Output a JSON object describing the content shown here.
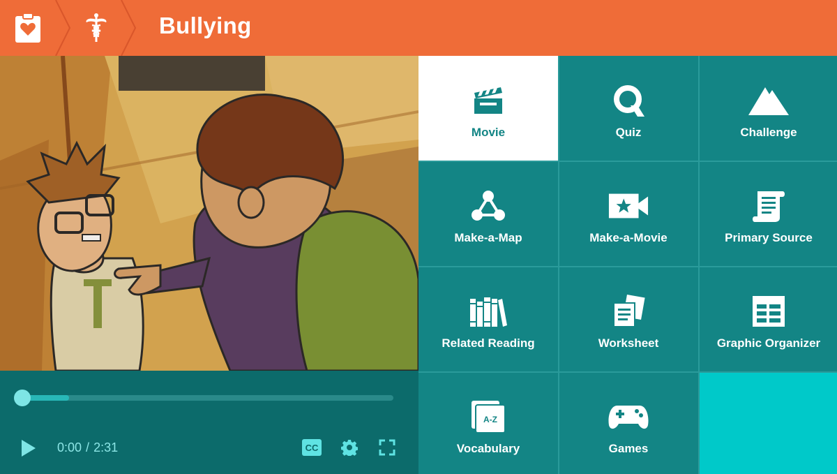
{
  "header": {
    "title": "Bullying",
    "breadcrumbs": [
      {
        "icon": "health-clipboard-icon"
      },
      {
        "icon": "caduceus-icon"
      }
    ],
    "color": "#ef6c38"
  },
  "video": {
    "current_time": "0:00",
    "separator": "/",
    "duration": "2:31",
    "buffered_fraction": 0.13,
    "played_fraction": 0.0,
    "cc_label": "CC"
  },
  "features": [
    {
      "label": "Movie",
      "icon": "clapperboard-icon",
      "active": true
    },
    {
      "label": "Quiz",
      "icon": "quiz-q-icon"
    },
    {
      "label": "Challenge",
      "icon": "mountain-icon"
    },
    {
      "label": "Make-a-Map",
      "icon": "concept-map-icon"
    },
    {
      "label": "Make-a-Movie",
      "icon": "movie-camera-star-icon"
    },
    {
      "label": "Primary Source",
      "icon": "scroll-icon"
    },
    {
      "label": "Related Reading",
      "icon": "books-icon"
    },
    {
      "label": "Worksheet",
      "icon": "worksheet-pages-icon"
    },
    {
      "label": "Graphic Organizer",
      "icon": "table-grid-icon"
    },
    {
      "label": "Vocabulary",
      "icon": "a-z-cards-icon",
      "card_text": "A-Z"
    },
    {
      "label": "Games",
      "icon": "gamepad-icon"
    }
  ],
  "colors": {
    "tile": "#138585",
    "tile_active": "#ffffff",
    "tile_empty": "#00c9c9",
    "controls": "#0c6b6b"
  }
}
